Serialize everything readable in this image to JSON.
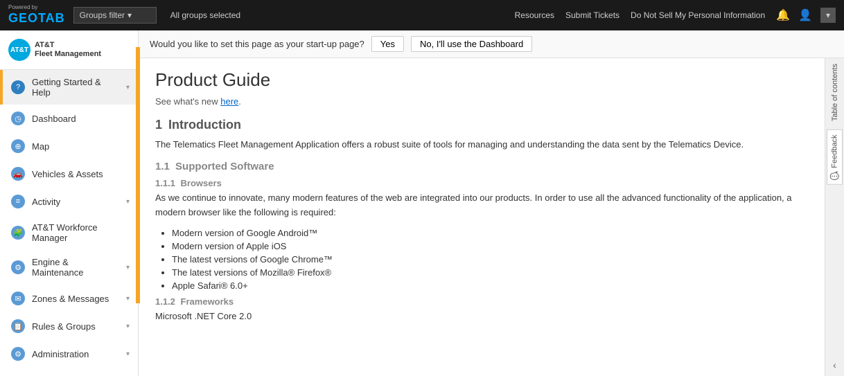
{
  "topbar": {
    "powered_by": "Powered by",
    "logo": "GEOTAB",
    "groups_filter_label": "Groups filter",
    "all_groups_label": "All groups selected",
    "links": [
      "Resources",
      "Submit Tickets",
      "Do Not Sell My Personal Information"
    ]
  },
  "att": {
    "logo_text": "AT&T",
    "subtitle": "Fleet Management"
  },
  "startup_bar": {
    "question": "Would you like to set this page as your start-up page?",
    "yes_label": "Yes",
    "no_label": "No, I'll use the Dashboard"
  },
  "sidebar": {
    "items": [
      {
        "id": "getting-started",
        "label": "Getting Started & Help",
        "icon": "?",
        "active": true,
        "has_chevron": true
      },
      {
        "id": "dashboard",
        "label": "Dashboard",
        "icon": "◷",
        "active": false,
        "has_chevron": false
      },
      {
        "id": "map",
        "label": "Map",
        "icon": "⊕",
        "active": false,
        "has_chevron": false
      },
      {
        "id": "vehicles",
        "label": "Vehicles & Assets",
        "icon": "🚗",
        "active": false,
        "has_chevron": false
      },
      {
        "id": "activity",
        "label": "Activity",
        "icon": "≡",
        "active": false,
        "has_chevron": true
      },
      {
        "id": "workforce",
        "label": "AT&T Workforce Manager",
        "icon": "🧩",
        "active": false,
        "has_chevron": false
      },
      {
        "id": "engine",
        "label": "Engine & Maintenance",
        "icon": "⚙",
        "active": false,
        "has_chevron": true
      },
      {
        "id": "zones",
        "label": "Zones & Messages",
        "icon": "✉",
        "active": false,
        "has_chevron": true
      },
      {
        "id": "rules",
        "label": "Rules & Groups",
        "icon": "📋",
        "active": false,
        "has_chevron": true
      },
      {
        "id": "admin",
        "label": "Administration",
        "icon": "⚙",
        "active": false,
        "has_chevron": true
      }
    ]
  },
  "toc": {
    "label": "Table of contents"
  },
  "feedback": {
    "label": "Feedback"
  },
  "content": {
    "title": "Product Guide",
    "see_new_prefix": "See what's new ",
    "see_new_link": "here",
    "see_new_suffix": ".",
    "sections": [
      {
        "num": "1",
        "heading": "Introduction",
        "body": "The Telematics Fleet Management Application offers a robust suite of tools for managing and understanding the data sent by the Telematics Device."
      }
    ],
    "subsections": [
      {
        "num": "1.1",
        "heading": "Supported Software"
      },
      {
        "num": "1.1.1",
        "heading": "Browsers",
        "body": "As we continue to innovate, many modern features of the web are integrated into our products. In order to use all the advanced functionality of the application, a modern browser like the following is required:"
      }
    ],
    "bullets": [
      "Modern version of Google Android™",
      "Modern version of Apple iOS",
      "The latest versions of Google Chrome™",
      "The latest versions of Mozilla® Firefox®",
      "Apple Safari® 6.0+"
    ],
    "frameworks": {
      "num": "1.1.2",
      "heading": "Frameworks",
      "body": "Microsoft .NET Core 2.0"
    }
  }
}
